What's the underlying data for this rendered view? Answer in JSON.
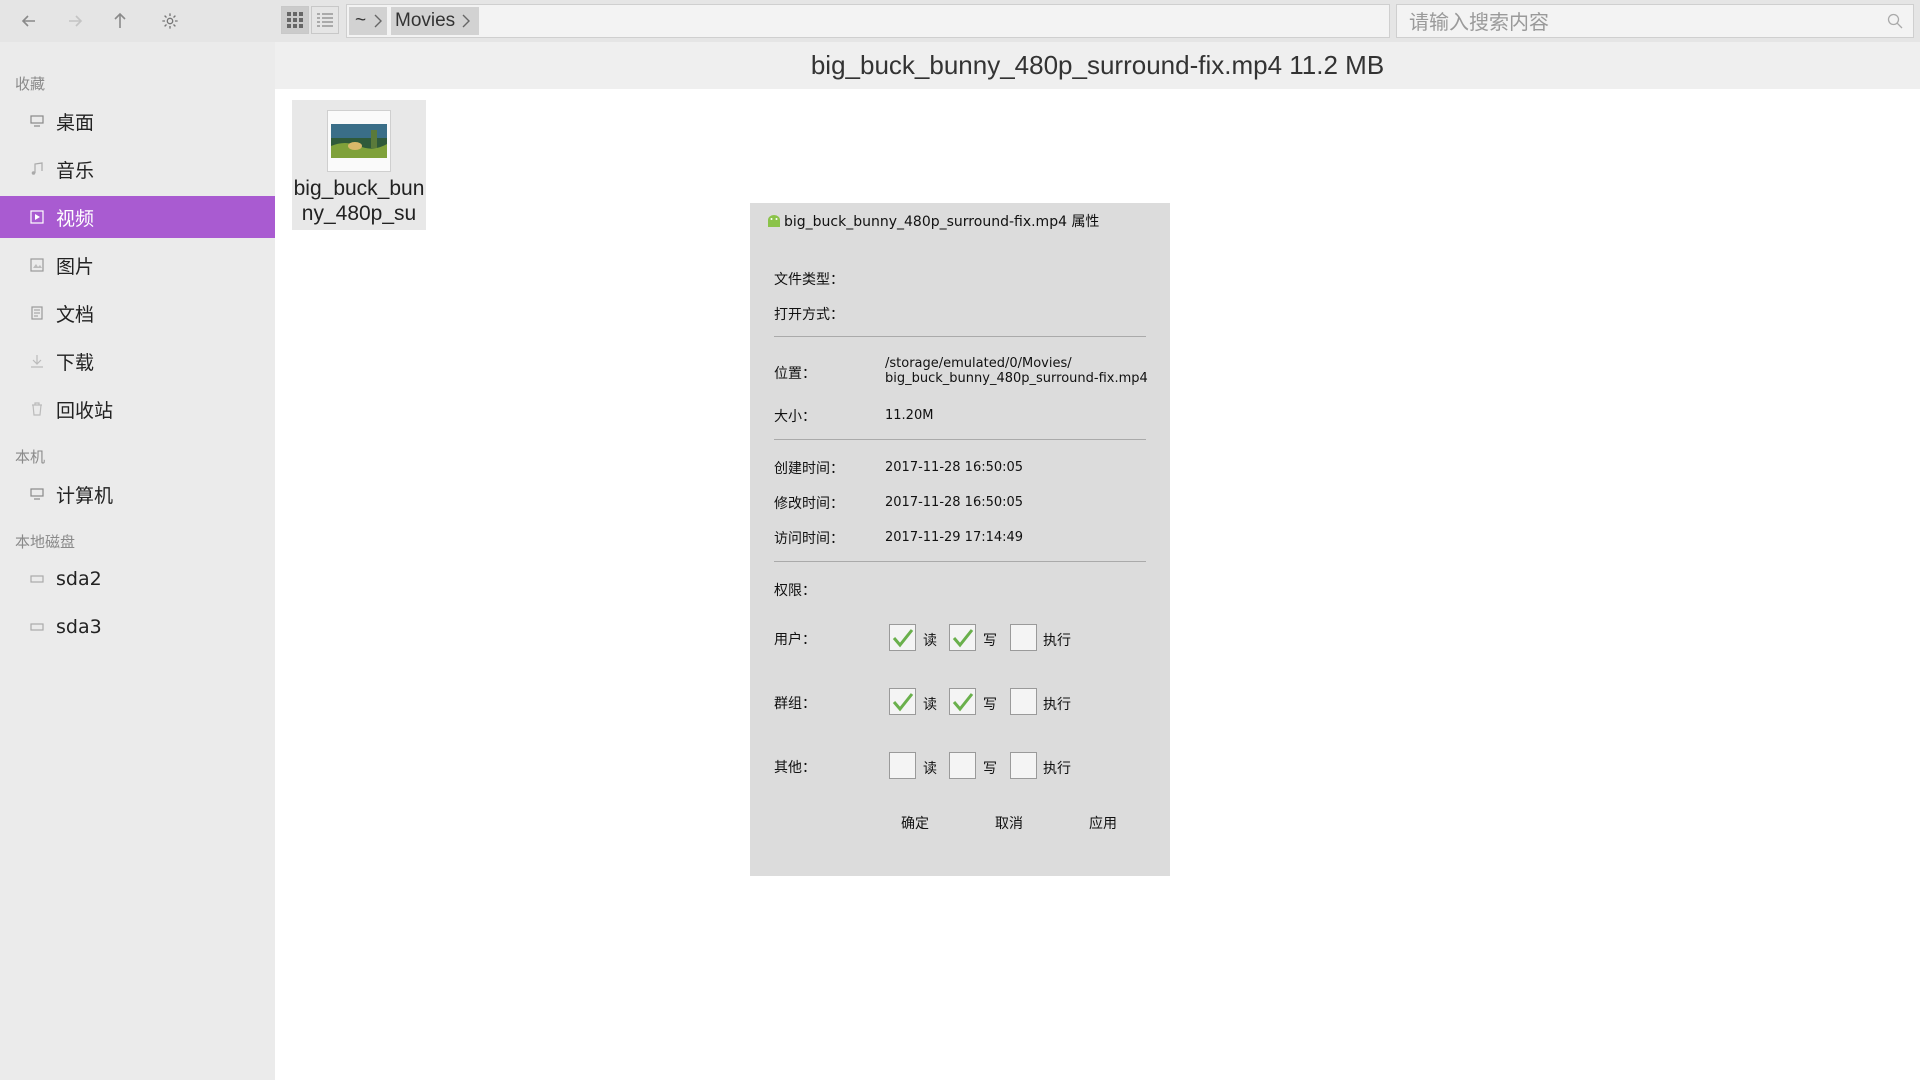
{
  "toolbar": {
    "path": [
      "~",
      "Movies"
    ],
    "search_placeholder": "请输入搜索内容"
  },
  "sidebar": {
    "sections": [
      {
        "label": "收藏",
        "items": [
          {
            "label": "桌面",
            "icon": "desktop-icon"
          },
          {
            "label": "音乐",
            "icon": "music-icon"
          },
          {
            "label": "视频",
            "icon": "video-icon",
            "active": true
          },
          {
            "label": "图片",
            "icon": "picture-icon"
          },
          {
            "label": "文档",
            "icon": "document-icon"
          },
          {
            "label": "下载",
            "icon": "download-icon"
          },
          {
            "label": "回收站",
            "icon": "trash-icon"
          }
        ]
      },
      {
        "label": "本机",
        "items": [
          {
            "label": "计算机",
            "icon": "computer-icon"
          }
        ]
      },
      {
        "label": "本地磁盘",
        "items": [
          {
            "label": "sda2",
            "icon": "disk-icon"
          },
          {
            "label": "sda3",
            "icon": "disk-icon"
          }
        ]
      }
    ],
    "accent_color": "#a95bd1"
  },
  "main": {
    "header": "big_buck_bunny_480p_surround-fix.mp4  11.2 MB",
    "file_name": "big_buck_bunny_480p_su"
  },
  "dialog": {
    "title": "big_buck_bunny_480p_surround-fix.mp4 属性",
    "file_type_label": "文件类型：",
    "open_with_label": "打开方式：",
    "location_label": "位置：",
    "location_value_line1": "/storage/emulated/0/Movies/",
    "location_value_line2": "big_buck_bunny_480p_surround-fix.mp4",
    "size_label": "大小：",
    "size_value": "11.20M",
    "created_label": "创建时间：",
    "created_value": "2017-11-28 16:50:05",
    "modified_label": "修改时间：",
    "modified_value": "2017-11-28 16:50:05",
    "accessed_label": "访问时间：",
    "accessed_value": "2017-11-29 17:14:49",
    "permissions_label": "权限：",
    "perm_read": "读",
    "perm_write": "写",
    "perm_exec": "执行",
    "rows": [
      {
        "label": "用户：",
        "read": true,
        "write": true,
        "exec": false
      },
      {
        "label": "群组：",
        "read": true,
        "write": true,
        "exec": false
      },
      {
        "label": "其他：",
        "read": false,
        "write": false,
        "exec": false
      }
    ],
    "ok": "确定",
    "cancel": "取消",
    "apply": "应用",
    "check_color": "#6ab04c"
  }
}
